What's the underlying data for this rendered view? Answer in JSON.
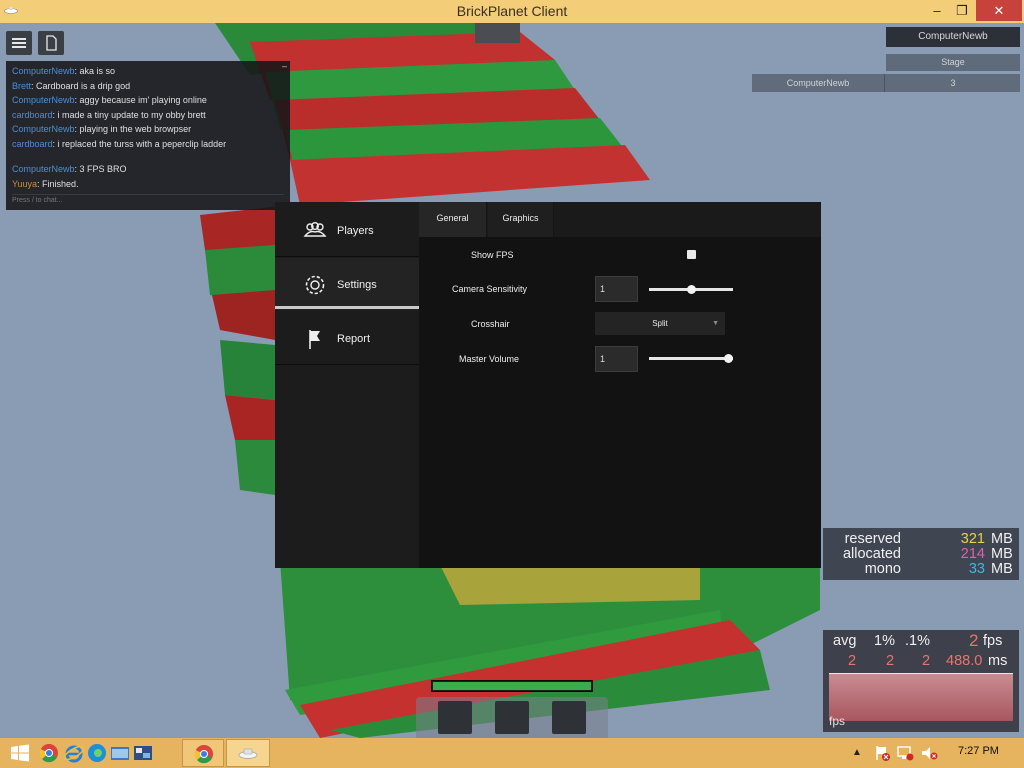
{
  "window": {
    "title": "BrickPlanet Client",
    "controls": {
      "minimize": "–",
      "maximize": "❐",
      "close": "✕"
    }
  },
  "hud": {
    "menu_icon": "hamburger-icon",
    "doc_icon": "document-icon"
  },
  "chat": {
    "messages": [
      {
        "user": "ComputerNewb",
        "sep": ": ",
        "text": "aka is so"
      },
      {
        "user": "Brett",
        "sep": ": ",
        "text": "Cardboard is a drip god"
      },
      {
        "user": "ComputerNewb",
        "sep": ": ",
        "text": "aggy because im' playing online"
      },
      {
        "user": "cardboard",
        "sep": ": ",
        "text": "i made a tiny update to my obby brett"
      },
      {
        "user": "ComputerNewb",
        "sep": ": ",
        "text": " playing in the web browpser"
      },
      {
        "user": "cardboard",
        "sep": ": ",
        "text": "i replaced the turss with a peperclip ladder"
      },
      {
        "user": "ComputerNewb",
        "sep": ": ",
        "text": "3 FPS BRO"
      },
      {
        "user": "Yuuya",
        "sep": ": ",
        "text": "Finished."
      }
    ],
    "input_placeholder": "Press / to chat..."
  },
  "leaderboard": {
    "local_player": "ComputerNewb",
    "column": "Stage",
    "rows": [
      {
        "name": "ComputerNewb",
        "stage": "3"
      }
    ]
  },
  "settings_menu": {
    "sidebar": [
      {
        "label": "Players",
        "icon": "players-icon"
      },
      {
        "label": "Settings",
        "icon": "gear-icon"
      },
      {
        "label": "Report",
        "icon": "flag-icon"
      }
    ],
    "tabs": [
      "General",
      "Graphics"
    ],
    "active_tab": "General",
    "show_fps": {
      "label": "Show FPS",
      "checked": false
    },
    "camera_sensitivity": {
      "label": "Camera Sensitivity",
      "value": "1",
      "slider_fraction": 0.5
    },
    "crosshair": {
      "label": "Crosshair",
      "value": "Split"
    },
    "master_volume": {
      "label": "Master Volume",
      "value": "1",
      "slider_fraction": 1.0
    }
  },
  "memory_stats": {
    "rows": [
      {
        "key": "reserved",
        "value": "321",
        "unit": "MB",
        "color": "#e9d04a"
      },
      {
        "key": "allocated",
        "value": "214",
        "unit": "MB",
        "color": "#e05fb0"
      },
      {
        "key": "mono",
        "value": "33",
        "unit": "MB",
        "color": "#3fb7de"
      }
    ]
  },
  "fps_stats": {
    "headers": {
      "avg": "avg",
      "p1": "1%",
      "p01": ".1%",
      "fps": "2",
      "fps_unit": "fps"
    },
    "values": {
      "avg": "2",
      "p1": "2",
      "p01": "2",
      "ms": "488.0",
      "ms_unit": "ms"
    },
    "graph_label": "fps"
  },
  "player": {
    "health_fraction": 1.0,
    "hotbar_slots": 3
  },
  "taskbar": {
    "start_icon": "windows-start-icon",
    "pinned": [
      "chrome-icon",
      "internet-explorer-icon",
      "edge-icon",
      "file-explorer-icon",
      "control-panel-icon"
    ],
    "running": [
      "chrome-icon",
      "brickplanet-icon"
    ],
    "clock": "7:27 PM"
  }
}
